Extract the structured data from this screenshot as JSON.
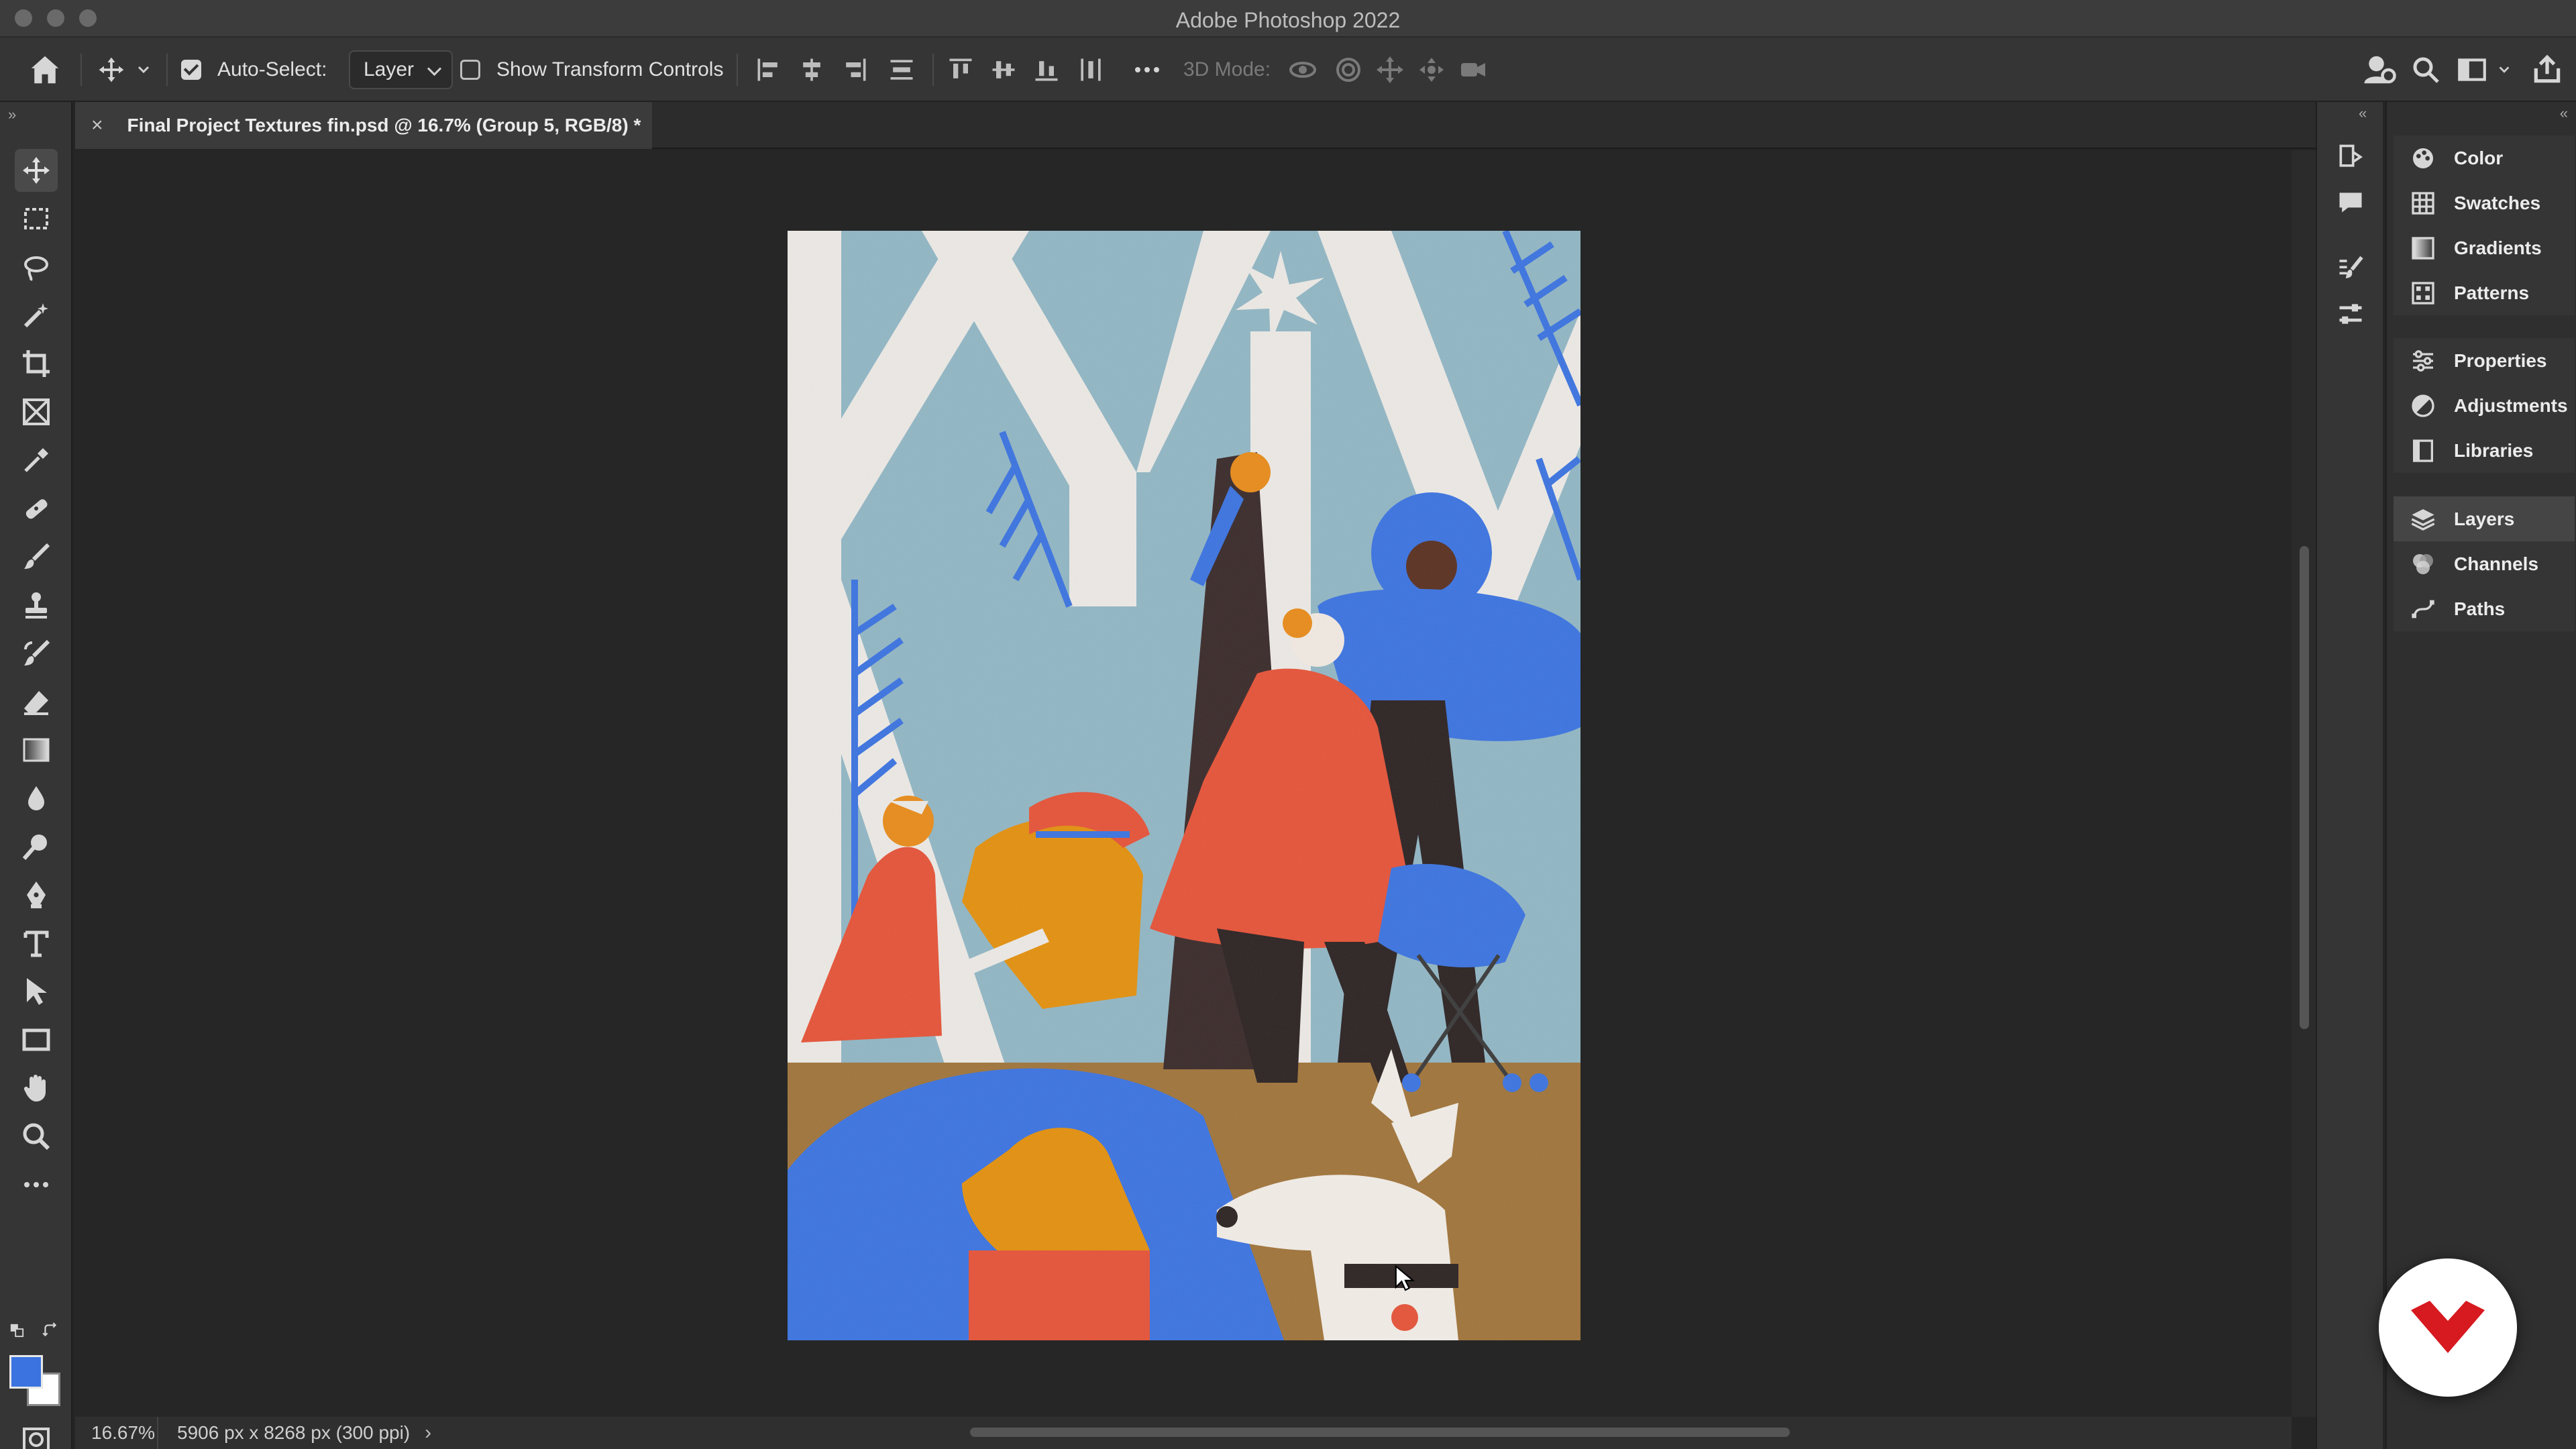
{
  "window": {
    "title": "Adobe Photoshop 2022"
  },
  "options_bar": {
    "auto_select_label": "Auto-Select:",
    "auto_select_checked": true,
    "auto_select_value": "Layer",
    "show_transform_label": "Show Transform Controls",
    "show_transform_checked": false,
    "three_d_mode_label": "3D Mode:"
  },
  "document": {
    "tab_title": "Final Project Textures fin.psd @ 16.7% (Group 5, RGB/8) *"
  },
  "status": {
    "zoom": "16.67%",
    "dimensions": "5906 px x 8268 px (300 ppi)"
  },
  "colors": {
    "foreground": "#3b73e0",
    "background": "#ffffff",
    "brand_badge": "#d71920"
  },
  "panels": {
    "group1": [
      {
        "label": "Color",
        "icon": "color-icon"
      },
      {
        "label": "Swatches",
        "icon": "swatches-icon"
      },
      {
        "label": "Gradients",
        "icon": "gradients-icon"
      },
      {
        "label": "Patterns",
        "icon": "patterns-icon"
      }
    ],
    "group2": [
      {
        "label": "Properties",
        "icon": "properties-icon"
      },
      {
        "label": "Adjustments",
        "icon": "adjustments-icon"
      },
      {
        "label": "Libraries",
        "icon": "libraries-icon"
      }
    ],
    "group3": [
      {
        "label": "Layers",
        "icon": "layers-icon",
        "active": true
      },
      {
        "label": "Channels",
        "icon": "channels-icon"
      },
      {
        "label": "Paths",
        "icon": "paths-icon"
      }
    ]
  },
  "tools": [
    "move-tool",
    "marquee-tool",
    "lasso-tool",
    "magic-wand-tool",
    "crop-tool",
    "frame-tool",
    "eyedropper-tool",
    "healing-brush-tool",
    "brush-tool",
    "clone-stamp-tool",
    "history-brush-tool",
    "eraser-tool",
    "gradient-tool",
    "blur-tool",
    "dodge-tool",
    "pen-tool",
    "type-tool",
    "path-selection-tool",
    "rectangle-tool",
    "hand-tool",
    "zoom-tool",
    "edit-toolbar"
  ]
}
